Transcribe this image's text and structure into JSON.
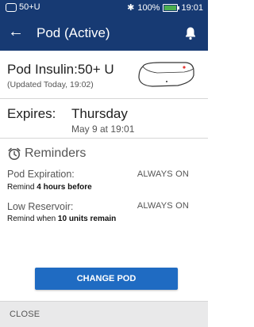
{
  "status_bar": {
    "left_text": "50+U",
    "battery_percent": "100%",
    "time": "19:01",
    "colors": {
      "background": "#173a73",
      "battery": "#4caf50"
    }
  },
  "app_bar": {
    "title": "Pod (Active)",
    "icons": {
      "back": "arrow-left-icon",
      "notifications": "bell-icon"
    }
  },
  "insulin": {
    "title": "Pod Insulin:50+ U",
    "updated": "(Updated Today, 19:02)"
  },
  "expires": {
    "label": "Expires:",
    "day": "Thursday",
    "date": "May 9 at 19:01"
  },
  "reminders": {
    "heading": "Reminders",
    "items": [
      {
        "name": "Pod Expiration:",
        "status": "ALWAYS ON",
        "detail_prefix": "Remind ",
        "detail_bold": "4 hours before",
        "detail_suffix": ""
      },
      {
        "name": "Low Reservoir:",
        "status": "ALWAYS ON",
        "detail_prefix": "Remind when ",
        "detail_bold": "10 units remain",
        "detail_suffix": ""
      }
    ]
  },
  "actions": {
    "change_pod": "CHANGE POD",
    "close": "CLOSE",
    "colors": {
      "primary": "#1f6bc2"
    }
  }
}
